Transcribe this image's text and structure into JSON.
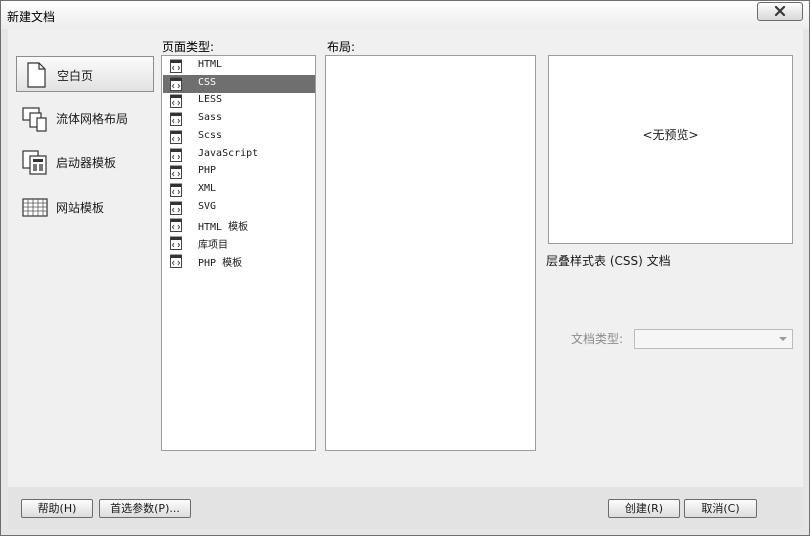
{
  "window": {
    "title": "新建文档",
    "close_icon": "close-icon"
  },
  "categories": [
    {
      "label": "空白页",
      "icon": "blank-page-icon",
      "selected": true
    },
    {
      "label": "流体网格布局",
      "icon": "fluid-grid-icon",
      "selected": false
    },
    {
      "label": "启动器模板",
      "icon": "starter-template-icon",
      "selected": false
    },
    {
      "label": "网站模板",
      "icon": "site-template-icon",
      "selected": false
    }
  ],
  "page_type": {
    "label": "页面类型:",
    "items": [
      {
        "label": "HTML",
        "selected": false
      },
      {
        "label": "CSS",
        "selected": true
      },
      {
        "label": "LESS",
        "selected": false
      },
      {
        "label": "Sass",
        "selected": false
      },
      {
        "label": "Scss",
        "selected": false
      },
      {
        "label": "JavaScript",
        "selected": false
      },
      {
        "label": "PHP",
        "selected": false
      },
      {
        "label": "XML",
        "selected": false
      },
      {
        "label": "SVG",
        "selected": false
      },
      {
        "label": "HTML 模板",
        "selected": false
      },
      {
        "label": "库项目",
        "selected": false
      },
      {
        "label": "PHP 模板",
        "selected": false
      }
    ]
  },
  "layout": {
    "label": "布局:"
  },
  "preview": {
    "text": "<无预览>"
  },
  "description": "层叠样式表 (CSS) 文档",
  "doctype": {
    "label": "文档类型:",
    "value": ""
  },
  "buttons": {
    "help": "帮助(H)",
    "preferences": "首选参数(P)...",
    "create": "创建(R)",
    "cancel": "取消(C)"
  }
}
